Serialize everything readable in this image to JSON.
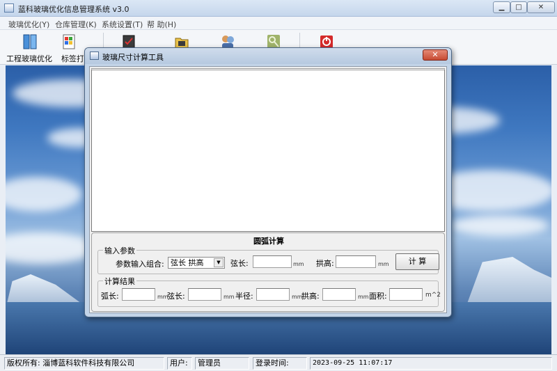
{
  "window": {
    "title": "蓝科玻璃优化信息管理系统 v3.0"
  },
  "menu": [
    "玻璃优化(Y)",
    "仓库管理(K)",
    "系统设置(T)",
    "帮 助(H)"
  ],
  "toolbar": [
    {
      "label": "工程玻璃优化",
      "icon": "book-icon"
    },
    {
      "label": "标签打",
      "icon": "label-print-icon"
    },
    {
      "label": "",
      "icon": "checklist-icon"
    },
    {
      "label": "",
      "icon": "folder-icon"
    },
    {
      "label": "",
      "icon": "people-search-icon"
    },
    {
      "label": "",
      "icon": "key-icon"
    },
    {
      "label": "",
      "icon": "power-icon"
    }
  ],
  "dialog": {
    "title": "玻璃尺寸计算工具",
    "close": "✕",
    "panel_title": "圆弧计算",
    "input_group": {
      "legend": "输入参数",
      "combo_label": "参数输入组合:",
      "combo_value": "弦长 拱高",
      "chord_label": "弦长:",
      "chord_unit": "mm",
      "height_label": "拱高:",
      "height_unit": "mm",
      "calc_button": "计 算"
    },
    "result_group": {
      "legend": "计算结果",
      "arc_label": "弧长:",
      "arc_unit": "mm",
      "chord_label": "弦长:",
      "chord_unit": "mm",
      "radius_label": "半径:",
      "radius_unit": "mm",
      "height_label": "拱高:",
      "height_unit": "mm",
      "area_label": "面积:",
      "area_unit": "m^2"
    }
  },
  "status": {
    "copyright": "版权所有: 淄博蓝科软件科技有限公司",
    "user_label": "用户:",
    "user_value": "管理员",
    "login_label": "登录时间:",
    "login_value": "2023-09-25  11:07:17"
  }
}
